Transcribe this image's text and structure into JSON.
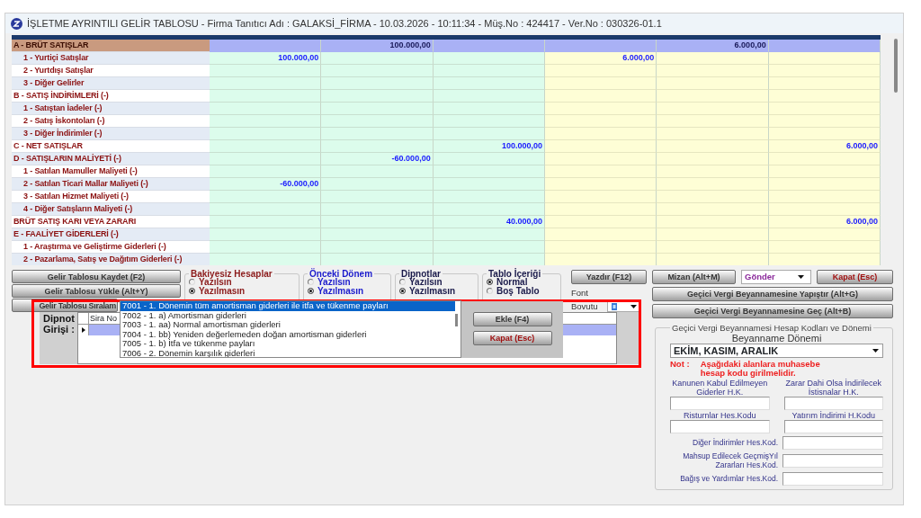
{
  "window": {
    "title": "İŞLETME AYRINTILI GELİR TABLOSU - Firma Tanıtıcı Adı : GALAKSİ_FİRMA - 10.03.2026 - 10:11:34 - Müş.No : 424417 - Ver.No : 030326-01.1"
  },
  "table": {
    "rows": [
      {
        "label": "A - BRÜT SATIŞLAR",
        "kind": "section",
        "selected": true,
        "values": {
          "column_2": "100.000,00",
          "column_5": "6.000,00"
        }
      },
      {
        "label": "1 - Yurtiçi Satışlar",
        "kind": "item",
        "selected": false,
        "values": {
          "column_1": "100.000,00",
          "column_4": "6.000,00"
        }
      },
      {
        "label": "2 - Yurtdışı Satışlar",
        "kind": "item",
        "selected": false
      },
      {
        "label": "3 - Diğer Gelirler",
        "kind": "item",
        "selected": false
      },
      {
        "label": "B - SATIŞ İNDİRİMLERİ (-)",
        "kind": "section",
        "selected": false
      },
      {
        "label": "1 - Satıştan İadeler (-)",
        "kind": "item",
        "selected": false
      },
      {
        "label": "2 - Satış İskontoları (-)",
        "kind": "item",
        "selected": false
      },
      {
        "label": "3 - Diğer İndirimler (-)",
        "kind": "item",
        "selected": false
      },
      {
        "label": "C - NET SATIŞLAR",
        "kind": "section",
        "selected": false,
        "values": {
          "column_3": "100.000,00",
          "column_6": "6.000,00"
        }
      },
      {
        "label": "D - SATIŞLARIN MALİYETİ (-)",
        "kind": "section",
        "selected": false,
        "values": {
          "column_2": "-60.000,00"
        }
      },
      {
        "label": "1 - Satılan Mamuller Maliyeti (-)",
        "kind": "item",
        "selected": false
      },
      {
        "label": "2 - Satılan Ticari Mallar Maliyeti (-)",
        "kind": "item",
        "selected": false,
        "values": {
          "column_1": "-60.000,00"
        }
      },
      {
        "label": "3 - Satılan Hizmet Maliyeti (-)",
        "kind": "item",
        "selected": false
      },
      {
        "label": "4 - Diğer Satışların Maliyeti (-)",
        "kind": "item",
        "selected": false
      },
      {
        "label": "BRÜT SATIŞ KARI VEYA ZARARI",
        "kind": "section",
        "selected": false,
        "values": {
          "column_3": "40.000,00",
          "column_6": "6.000,00"
        }
      },
      {
        "label": "E - FAALİYET GİDERLERİ (-)",
        "kind": "section",
        "selected": false
      },
      {
        "label": "1 - Araştırma ve Geliştirme Giderleri (-)",
        "kind": "item",
        "selected": false
      },
      {
        "label": "2 - Pazarlama, Satış ve Dağıtım Giderleri (-)",
        "kind": "item",
        "selected": false
      }
    ]
  },
  "table_buttons": [
    "Gelir Tablosu Kaydet (F2)",
    "Gelir Tablosu Yükle (Alt+Y)",
    "Gelir Tablosu Sıralam"
  ],
  "option_groups": [
    {
      "title": "Bakiyesiz Hesaplar",
      "color": "#8b1a1a",
      "options": [
        {
          "label": "Yazılsın",
          "selected": false
        },
        {
          "label": "Yazılmasın",
          "selected": true
        }
      ]
    },
    {
      "title": "Önceki Dönem",
      "color": "#1a1acc",
      "options": [
        {
          "label": "Yazılsın",
          "selected": false
        },
        {
          "label": "Yazılmasın",
          "selected": true
        }
      ]
    },
    {
      "title": "Dipnotlar",
      "color": "#1a1a4a",
      "options": [
        {
          "label": "Yazılsın",
          "selected": false
        },
        {
          "label": "Yazılmasın",
          "selected": true
        }
      ]
    },
    {
      "title": "Tablo İçeriği",
      "color": "#1a1a4a",
      "options": [
        {
          "label": "Normal",
          "selected": true
        },
        {
          "label": "Boş Tablo",
          "selected": false
        }
      ]
    }
  ],
  "toolbar": [
    {
      "label": "Yazdır (F12)",
      "kind": "button"
    },
    {
      "label": "Mizan (Alt+M)",
      "kind": "button"
    },
    {
      "label": "Gönder",
      "kind": "dropdown"
    },
    {
      "label": "Kapat (Esc)",
      "kind": "danger"
    }
  ],
  "font_size": {
    "label": "Font Bovutu"
  },
  "actions": [
    "Geçici Vergi Beyannamesine Yapıştır  (Alt+G)",
    "Geçici Vergi Beyannamesine Geç (Alt+B)"
  ],
  "footnote_popup": {
    "label": "Dipnot Girişi :",
    "grid_column": "Sira No",
    "list": [
      {
        "text": "7001 - 1. Dönemin tüm amortisman giderleri ile itfa ve tükenme payları",
        "selected": true
      },
      {
        "text": "7002 - 1. a) Amortisman giderleri",
        "selected": false
      },
      {
        "text": "7003 - 1. aa) Normal amortisman giderleri",
        "selected": false
      },
      {
        "text": "7004 - 1. bb) Yeniden değerlemeden doğan amortisman giderleri",
        "selected": false
      },
      {
        "text": "7005 - 1. b) İtfa ve tükenme payları",
        "selected": false
      },
      {
        "text": "7006 - 2. Dönemin karşılık giderleri",
        "selected": false
      }
    ],
    "buttons": [
      {
        "label": "Ekle (F4)",
        "kind": "button"
      },
      {
        "label": "Kapat (Esc)",
        "kind": "danger"
      }
    ]
  },
  "tax_group": {
    "title": "Geçici Vergi Beyannamesi Hesap Kodları ve Dönemi",
    "period_label": "Beyanname Dönemi",
    "period": "EKİM, KASIM, ARALIK",
    "note_label": "Not :",
    "note": "Aşağıdaki alanlara muhasebe hesap kodu girilmelidir.",
    "fields": [
      {
        "label": "Kanunen Kabul Edilmeyen Giderler H.K.",
        "kind": "stacked"
      },
      {
        "label": "Zarar Dahi Olsa İndirilecek İstisnalar H.K.",
        "kind": "stacked"
      },
      {
        "label": "Risturnlar Hes.Kodu",
        "kind": "stacked"
      },
      {
        "label": "Yatırım İndirimi H.Kodu",
        "kind": "stacked"
      },
      {
        "label": "Diğer İndirimler Hes.Kod.",
        "kind": "inline"
      },
      {
        "label": "Mahsup Edilecek GeçmişYıl Zararları Hes.Kod.",
        "kind": "inline"
      },
      {
        "label": "Bağış ve Yardımlar Hes.Kod.",
        "kind": "inline"
      }
    ]
  }
}
